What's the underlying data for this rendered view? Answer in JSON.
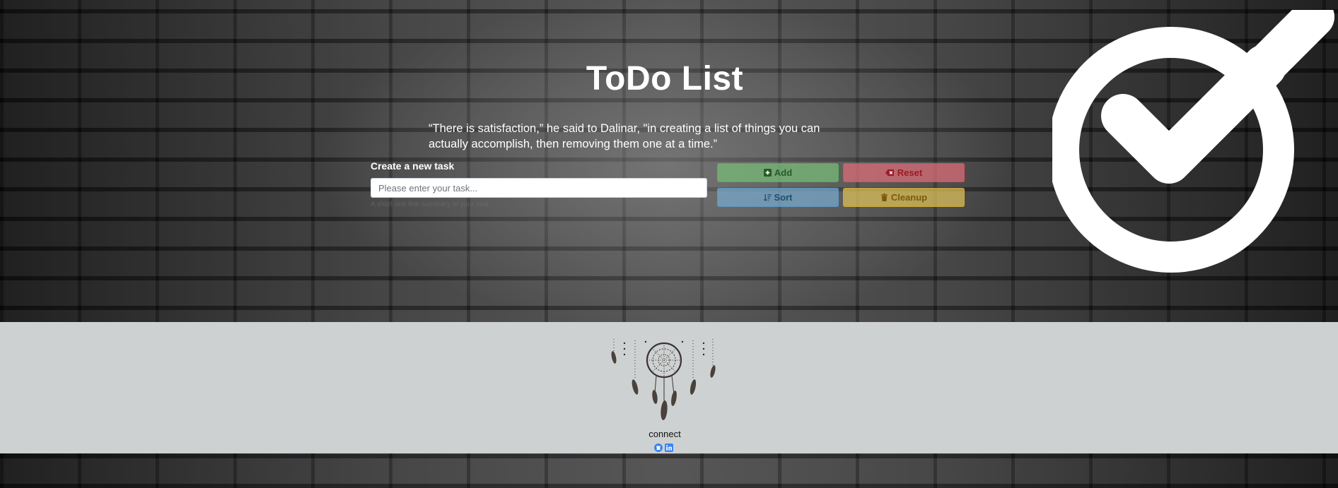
{
  "header": {
    "title": "ToDo List",
    "quote": "“There is satisfaction,” he said to Dalinar, \"in creating a list of things you can actually accomplish, then removing them one at a time.”"
  },
  "form": {
    "label": "Create a new task",
    "input_placeholder": "Please enter your task...",
    "input_value": "",
    "help_text": "A short one line summary of your task"
  },
  "buttons": {
    "add": "Add",
    "reset": "Reset",
    "sort": "Sort",
    "cleanup": "Cleanup"
  },
  "footer": {
    "connect_label": "connect",
    "links": [
      "github-icon",
      "linkedin-icon"
    ]
  },
  "colors": {
    "add": "#78be78",
    "reset": "#e16e78",
    "sort": "#78aacd",
    "cleanup": "#e1c35a",
    "footer_bg": "#ced1d2",
    "social_blue": "#3b82f6"
  }
}
